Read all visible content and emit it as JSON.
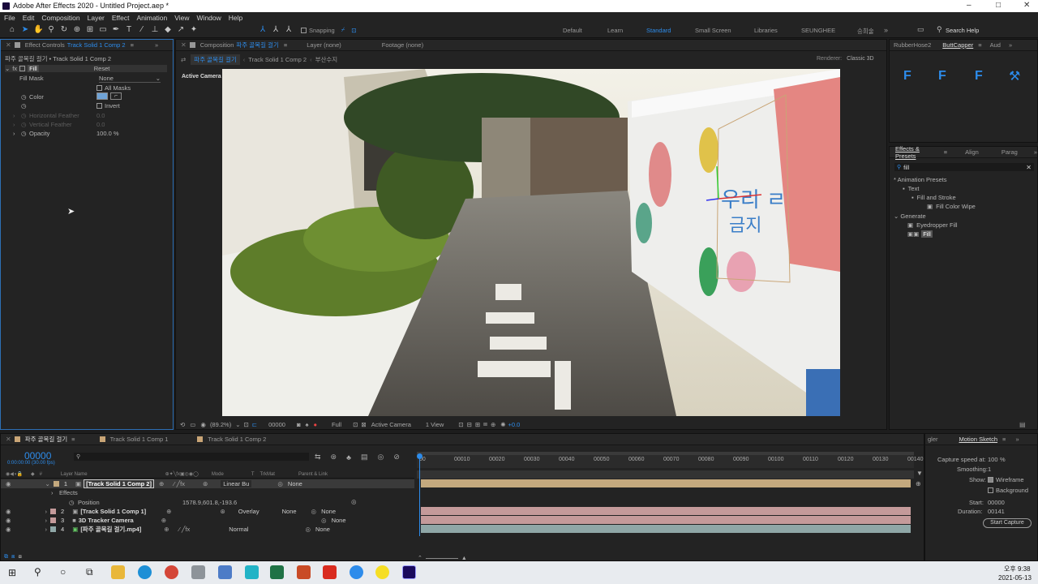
{
  "app": {
    "title": "Adobe After Effects 2020 - Untitled Project.aep *"
  },
  "menu": [
    "File",
    "Edit",
    "Composition",
    "Layer",
    "Effect",
    "Animation",
    "View",
    "Window",
    "Help"
  ],
  "toolbar": {
    "snapping": "Snapping"
  },
  "workspaces": [
    "Default",
    "Learn",
    "Standard",
    "Small Screen",
    "Libraries",
    "SEUNGHEE",
    "승희술"
  ],
  "search_help": "Search Help",
  "effect_controls": {
    "tab": "Effect Controls",
    "tab_layer": "Track Solid 1 Comp 2",
    "breadcrumb": "파주 골목길 걸기 • Track Solid 1 Comp 2",
    "fx_name": "Fill",
    "reset": "Reset",
    "fill_mask": "Fill Mask",
    "fill_mask_value": "None",
    "all_masks": "All Masks",
    "color": "Color",
    "invert": "Invert",
    "h_feather": "Horizontal Feather",
    "h_feather_v": "0.0",
    "v_feather": "Vertical Feather",
    "v_feather_v": "0.0",
    "opacity": "Opacity",
    "opacity_v": "100.0 %"
  },
  "composition": {
    "tab": "Composition",
    "tab_name": "파주 골목길 걸기",
    "layer_tab": "Layer  (none)",
    "footage_tab": "Footage  (none)",
    "breadcrumbs": [
      "파주 골목길 걸기",
      "Track Solid 1 Comp 2",
      "부산수지"
    ],
    "renderer_label": "Renderer:",
    "renderer": "Classic 3D",
    "active_camera": "Active Camera",
    "footer": {
      "zoom": "(89.2%)",
      "time": "00000",
      "resolution": "Full",
      "view": "Active Camera",
      "views": "1 View",
      "exposure": "+0.0"
    }
  },
  "right_top": {
    "tabs": [
      "RubberHose2",
      "ButtCapper",
      "Aud"
    ]
  },
  "effects_presets": {
    "tabs": [
      "Effects & Presets",
      "Align",
      "Parag"
    ],
    "search": "fill",
    "tree": [
      {
        "label": "* Animation Presets",
        "depth": 0
      },
      {
        "label": "Text",
        "depth": 1
      },
      {
        "label": "Fill and Stroke",
        "depth": 2
      },
      {
        "label": "Fill Color Wipe",
        "depth": 3
      },
      {
        "label": "Generate",
        "depth": 0
      },
      {
        "label": "Eyedropper Fill",
        "depth": 1
      },
      {
        "label": "Fill",
        "depth": 1
      }
    ]
  },
  "timeline": {
    "tabs": [
      "파주 골목길 걸기",
      "Track Solid 1 Comp 1",
      "Track Solid 1 Comp 2"
    ],
    "time": "00000",
    "fps": "0:00:00:00 (30.00 fps)",
    "col_layer": "Layer Name",
    "col_mode": "Mode",
    "col_t": "T",
    "col_trkmat": "TrkMat",
    "col_parent": "Parent & Link",
    "ruler": [
      "00",
      "00010",
      "00020",
      "00030",
      "00040",
      "00050",
      "00060",
      "00070",
      "00080",
      "00090",
      "00100",
      "00110",
      "00120",
      "00130",
      "00140"
    ],
    "layers": [
      {
        "num": "1",
        "name": "[Track Solid 1 Comp 2]",
        "mode": "Linear Bu",
        "trkmat": "",
        "parent": "None",
        "color": "#c4a97e"
      },
      {
        "num": "2",
        "name": "[Track Solid 1 Comp 1]",
        "mode": "Overlay",
        "trkmat": "None",
        "parent": "None",
        "color": "#c49a9a"
      },
      {
        "num": "3",
        "name": "3D Tracker Camera",
        "mode": "",
        "trkmat": "",
        "parent": "None",
        "color": "#c49a9a"
      },
      {
        "num": "4",
        "name": "[파주 골목길 걸기.mp4]",
        "mode": "Normal",
        "trkmat": "",
        "parent": "None",
        "color": "#8fa7a7"
      }
    ],
    "effects": "Effects",
    "position": "Position",
    "position_v": "1578.9,601.8,-193.6"
  },
  "motion_sketch": {
    "tabs": [
      "gler",
      "Motion Sketch"
    ],
    "capture_speed": "Capture speed at:",
    "capture_speed_v": "100",
    "pct": "%",
    "smoothing": "Smoothing:",
    "smoothing_v": "1",
    "show": "Show:",
    "wireframe": "Wireframe",
    "background": "Background",
    "start": "Start:",
    "start_v": "00000",
    "duration": "Duration:",
    "duration_v": "00141",
    "start_capture": "Start Capture"
  },
  "clock": {
    "time": "오후 9:38",
    "date": "2021-05-13"
  }
}
